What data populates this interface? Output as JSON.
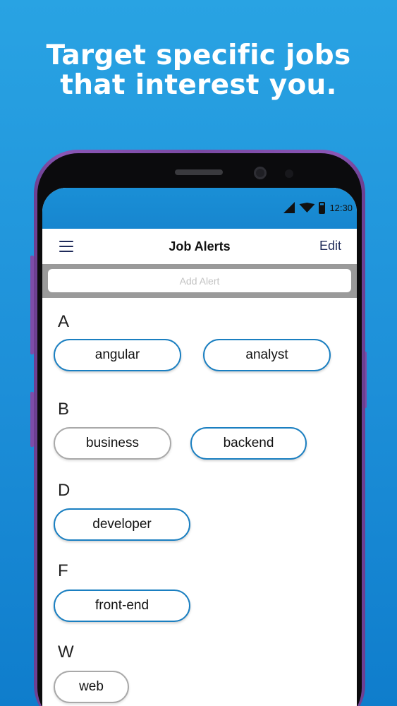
{
  "headline": {
    "line1": "Target specific jobs",
    "line2": "that interest you."
  },
  "status_bar": {
    "time": "12:30",
    "icons": [
      "signal-icon",
      "wifi-icon",
      "battery-icon"
    ]
  },
  "app_bar": {
    "menu_icon": "hamburger-menu-icon",
    "title": "Job Alerts",
    "edit_label": "Edit"
  },
  "search": {
    "placeholder": "Add Alert"
  },
  "sections": [
    {
      "letter": "A",
      "alerts": [
        {
          "label": "angular",
          "style": "blue"
        },
        {
          "label": "analyst",
          "style": "blue"
        }
      ]
    },
    {
      "letter": "B",
      "alerts": [
        {
          "label": "business",
          "style": "grey"
        },
        {
          "label": "backend",
          "style": "blue"
        }
      ]
    },
    {
      "letter": "D",
      "alerts": [
        {
          "label": "developer",
          "style": "blue"
        }
      ]
    },
    {
      "letter": "F",
      "alerts": [
        {
          "label": "front-end",
          "style": "blue"
        }
      ]
    },
    {
      "letter": "W",
      "alerts": [
        {
          "label": "web",
          "style": "grey"
        }
      ]
    }
  ],
  "colors": {
    "background": "#1d8fd8",
    "accent": "#1a7fc1",
    "chip_grey": "#a9a9a9",
    "nav_text": "#1f2b5a"
  }
}
